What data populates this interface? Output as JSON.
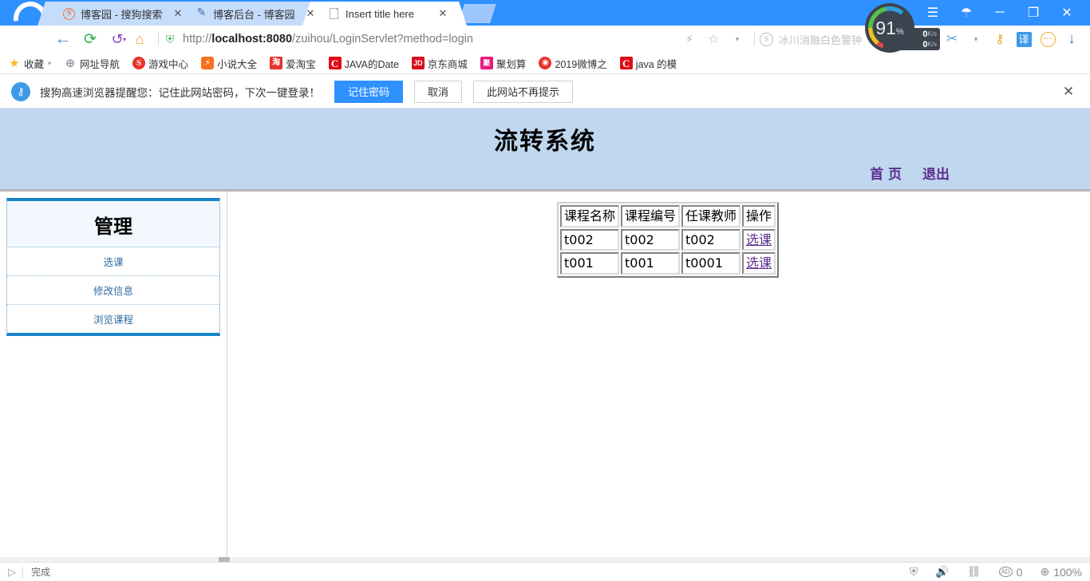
{
  "browser": {
    "tabs": [
      {
        "title": "博客园 - 搜狗搜索",
        "favicon": "sogou-icon",
        "active": false,
        "close_label": "✕"
      },
      {
        "title": "博客后台 - 博客园",
        "favicon": "blog-icon",
        "active": false,
        "close_label": "✕"
      },
      {
        "title": "Insert title here",
        "favicon": "page-icon",
        "active": true,
        "close_label": "✕"
      }
    ],
    "window_controls": {
      "menu": "☰",
      "skin": "☂",
      "minimize": "─",
      "maximize": "❐",
      "close": "✕"
    },
    "nav": {
      "back": "←",
      "reload": "⟳",
      "history": "↺",
      "history_caret": "▾",
      "home": "⌂",
      "shield": "⛨",
      "url_prefix": "http://",
      "url_host": "localhost:8080",
      "url_path": "/zuihou/LoginServlet?method=login",
      "lightning": "⚡",
      "star": "☆",
      "star_caret": "▾",
      "sogou_badge": "S",
      "sogou_text": "冰川消融白色警钟",
      "scissors": "✂",
      "scissors_caret": "▾",
      "key": "⚷",
      "translate": "译",
      "more": "⋯",
      "download": "↓"
    },
    "performance": {
      "memory_percent": "91",
      "memory_unit": "%",
      "upload_speed": "0",
      "upload_unit": "K/s",
      "download_speed": "0",
      "download_unit": "K/s",
      "up_arrow": "↑",
      "down_arrow": "↓"
    },
    "bookmarks": [
      {
        "label": "收藏",
        "icon": "star-icon",
        "icon_glyph": "★",
        "icon_class": "i-star",
        "caret": "▾"
      },
      {
        "label": "网址导航",
        "icon": "globe-icon",
        "icon_glyph": "⊕",
        "icon_class": "i-globe",
        "caret": ""
      },
      {
        "label": "游戏中心",
        "icon": "sogou-icon",
        "icon_glyph": "S",
        "icon_class": "i-sogou",
        "caret": ""
      },
      {
        "label": "小说大全",
        "icon": "novel-icon",
        "icon_glyph": "⚡",
        "icon_class": "i-novel",
        "caret": ""
      },
      {
        "label": "爱淘宝",
        "icon": "taobao-icon",
        "icon_glyph": "淘",
        "icon_class": "i-taobao",
        "caret": ""
      },
      {
        "label": "JAVA的Date",
        "icon": "csdn-icon",
        "icon_glyph": "C",
        "icon_class": "i-java",
        "caret": ""
      },
      {
        "label": "京东商城",
        "icon": "jd-icon",
        "icon_glyph": "JD",
        "icon_class": "i-jd",
        "caret": ""
      },
      {
        "label": "聚划算",
        "icon": "juhuasuan-icon",
        "icon_glyph": "聚",
        "icon_class": "i-ju",
        "caret": ""
      },
      {
        "label": "2019微博之",
        "icon": "weibo-icon",
        "icon_glyph": "◉",
        "icon_class": "i-weibo",
        "caret": ""
      },
      {
        "label": "java 的模",
        "icon": "csdn-icon",
        "icon_glyph": "C",
        "icon_class": "i-java",
        "caret": ""
      }
    ],
    "notification": {
      "icon": "key-icon",
      "icon_glyph": "⚷",
      "message": "搜狗高速浏览器提醒您：记住此网站密码，下次一键登录！",
      "save_label": "记住密码",
      "cancel_label": "取消",
      "never_label": "此网站不再提示",
      "close_glyph": "✕"
    },
    "statusbar": {
      "play_glyph": "▷",
      "status_text": "完成",
      "shield_glyph": "⛨",
      "sound_glyph": "ὐa",
      "toolbox_glyph": "⊕",
      "ad_glyph": "AD",
      "ad_count": "0",
      "zoom_glyph": "⊕",
      "zoom_level": "100%"
    }
  },
  "webpage": {
    "header_title": "流转系统",
    "nav_links": [
      {
        "label": "首 页"
      },
      {
        "label": "退出"
      }
    ],
    "sidebar": {
      "title": "管理",
      "items": [
        {
          "label": "选课"
        },
        {
          "label": "修改信息"
        },
        {
          "label": "浏览课程"
        }
      ]
    },
    "table": {
      "headers": [
        "课程名称",
        "课程编号",
        "任课教师",
        "操作"
      ],
      "rows": [
        {
          "name": "t002",
          "code": "t002",
          "teacher": "t002",
          "action": "选课"
        },
        {
          "name": "t001",
          "code": "t001",
          "teacher": "t0001",
          "action": "选课"
        }
      ]
    }
  },
  "colors": {
    "browser_blue": "#2f90ff",
    "page_header_blue": "#bfd7ef",
    "link_purple": "#5b2e8e",
    "menu_accent": "#1a86c8"
  }
}
